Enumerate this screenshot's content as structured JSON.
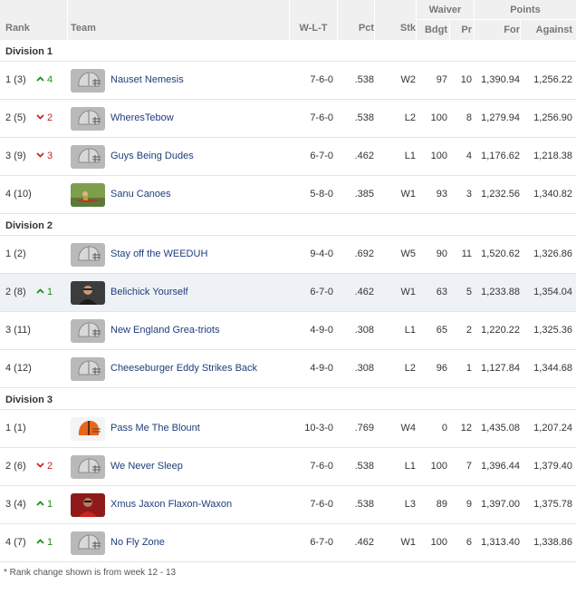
{
  "headers": {
    "rank": "Rank",
    "team": "Team",
    "wlt": "W-L-T",
    "pct": "Pct",
    "stk": "Stk",
    "waiver": "Waiver",
    "bdgt": "Bdgt",
    "pr": "Pr",
    "points": "Points",
    "for": "For",
    "against": "Against"
  },
  "colors": {
    "up": "#1a8f1a",
    "down": "#cc2222",
    "team_link": "#1f3d7a",
    "header_bg": "#f0f0f0",
    "highlight_row": "#eef2f6"
  },
  "divisions": [
    {
      "title": "Division 1",
      "teams": [
        {
          "rank": "1 (3)",
          "dir": "up",
          "change": "4",
          "logo": "helmet-icon",
          "name": "Nauset Nemesis",
          "wlt": "7-6-0",
          "pct": ".538",
          "stk": "W2",
          "bdgt": "97",
          "pr": "10",
          "for": "1,390.94",
          "against": "1,256.22"
        },
        {
          "rank": "2 (5)",
          "dir": "down",
          "change": "2",
          "logo": "helmet-icon",
          "name": "WheresTebow",
          "wlt": "7-6-0",
          "pct": ".538",
          "stk": "L2",
          "bdgt": "100",
          "pr": "8",
          "for": "1,279.94",
          "against": "1,256.90"
        },
        {
          "rank": "3 (9)",
          "dir": "down",
          "change": "3",
          "logo": "helmet-icon",
          "name": "Guys Being Dudes",
          "wlt": "6-7-0",
          "pct": ".462",
          "stk": "L1",
          "bdgt": "100",
          "pr": "4",
          "for": "1,176.62",
          "against": "1,218.38"
        },
        {
          "rank": "4 (10)",
          "dir": "",
          "change": "",
          "logo": "canoe-photo-icon",
          "name": "Sanu Canoes",
          "wlt": "5-8-0",
          "pct": ".385",
          "stk": "W1",
          "bdgt": "93",
          "pr": "3",
          "for": "1,232.56",
          "against": "1,340.82"
        }
      ]
    },
    {
      "title": "Division 2",
      "teams": [
        {
          "rank": "1 (2)",
          "dir": "",
          "change": "",
          "logo": "helmet-icon",
          "name": "Stay off the WEEDUH",
          "wlt": "9-4-0",
          "pct": ".692",
          "stk": "W5",
          "bdgt": "90",
          "pr": "11",
          "for": "1,520.62",
          "against": "1,326.86"
        },
        {
          "rank": "2 (8)",
          "dir": "up",
          "change": "1",
          "logo": "person-photo-icon",
          "name": "Belichick Yourself",
          "wlt": "6-7-0",
          "pct": ".462",
          "stk": "W1",
          "bdgt": "63",
          "pr": "5",
          "for": "1,233.88",
          "against": "1,354.04",
          "highlight": true
        },
        {
          "rank": "3 (11)",
          "dir": "",
          "change": "",
          "logo": "helmet-icon",
          "name": "New England Grea-triots",
          "wlt": "4-9-0",
          "pct": ".308",
          "stk": "L1",
          "bdgt": "65",
          "pr": "2",
          "for": "1,220.22",
          "against": "1,325.36"
        },
        {
          "rank": "4 (12)",
          "dir": "",
          "change": "",
          "logo": "helmet-icon",
          "name": "Cheeseburger Eddy Strikes Back",
          "wlt": "4-9-0",
          "pct": ".308",
          "stk": "L2",
          "bdgt": "96",
          "pr": "1",
          "for": "1,127.84",
          "against": "1,344.68"
        }
      ]
    },
    {
      "title": "Division 3",
      "teams": [
        {
          "rank": "1 (1)",
          "dir": "",
          "change": "",
          "logo": "orange-helmet-icon",
          "name": "Pass Me The Blount",
          "wlt": "10-3-0",
          "pct": ".769",
          "stk": "W4",
          "bdgt": "0",
          "pr": "12",
          "for": "1,435.08",
          "against": "1,207.24"
        },
        {
          "rank": "2 (6)",
          "dir": "down",
          "change": "2",
          "logo": "helmet-icon",
          "name": "We Never Sleep",
          "wlt": "7-6-0",
          "pct": ".538",
          "stk": "L1",
          "bdgt": "100",
          "pr": "7",
          "for": "1,396.44",
          "against": "1,379.40"
        },
        {
          "rank": "3 (4)",
          "dir": "up",
          "change": "1",
          "logo": "person-photo-icon",
          "name": "Xmus Jaxon Flaxon-Waxon",
          "wlt": "7-6-0",
          "pct": ".538",
          "stk": "L3",
          "bdgt": "89",
          "pr": "9",
          "for": "1,397.00",
          "against": "1,375.78"
        },
        {
          "rank": "4 (7)",
          "dir": "up",
          "change": "1",
          "logo": "helmet-icon",
          "name": "No Fly Zone",
          "wlt": "6-7-0",
          "pct": ".462",
          "stk": "W1",
          "bdgt": "100",
          "pr": "6",
          "for": "1,313.40",
          "against": "1,338.86"
        }
      ]
    }
  ],
  "footnote": "* Rank change shown is from week 12 - 13"
}
